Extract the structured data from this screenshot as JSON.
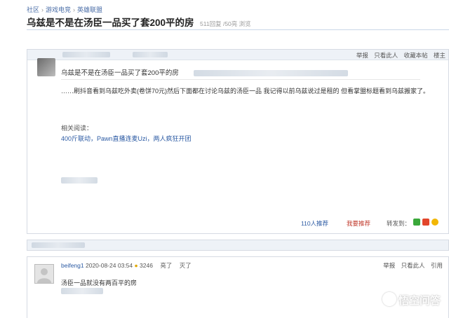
{
  "breadcrumb": {
    "items": [
      "社区",
      "游戏电竞",
      "英雄联盟"
    ],
    "separator": "›"
  },
  "thread": {
    "title": "乌兹是不是在汤臣一品买了套200平的房",
    "stats": "511回复 /50亮 浏览"
  },
  "post1": {
    "actions": [
      "举报",
      "只看此人",
      "收藏本帖",
      "楼主"
    ],
    "quote_title": "乌兹是不是在汤臣一品买了套200平的房",
    "body": "……刷抖音看到乌兹吃外卖(卷饼70元)然后下面都在讨论乌兹的汤臣一品 我记得以前乌兹说过是租的 但看掌盟标题看到乌兹搬家了。",
    "related_label": "相关阅读：",
    "related_links": "400斤联动，Pawn直播连麦Uzi，两人疯狂开团",
    "recommend": "110人推荐",
    "want_recommend": "我要推荐",
    "send_to": "转发到："
  },
  "post2": {
    "username": "beifeng1",
    "datetime": "2020-08-24 03:54",
    "light_count": "3246",
    "light": "亮了",
    "dark": "灭了",
    "actions": [
      "举报",
      "只看此人",
      "引用"
    ],
    "text": "汤臣一品就没有两百平的房"
  },
  "watermark": {
    "text": "悟空问答"
  },
  "icons": {
    "avatar": "default-avatar-icon",
    "bulb": "light-bulb-icon",
    "share": [
      "wechat-icon",
      "weibo-icon",
      "qzone-icon"
    ]
  },
  "colors": {
    "link": "#2b5aa3",
    "want": "#c0392b",
    "header_bg": "#eef2f7"
  }
}
